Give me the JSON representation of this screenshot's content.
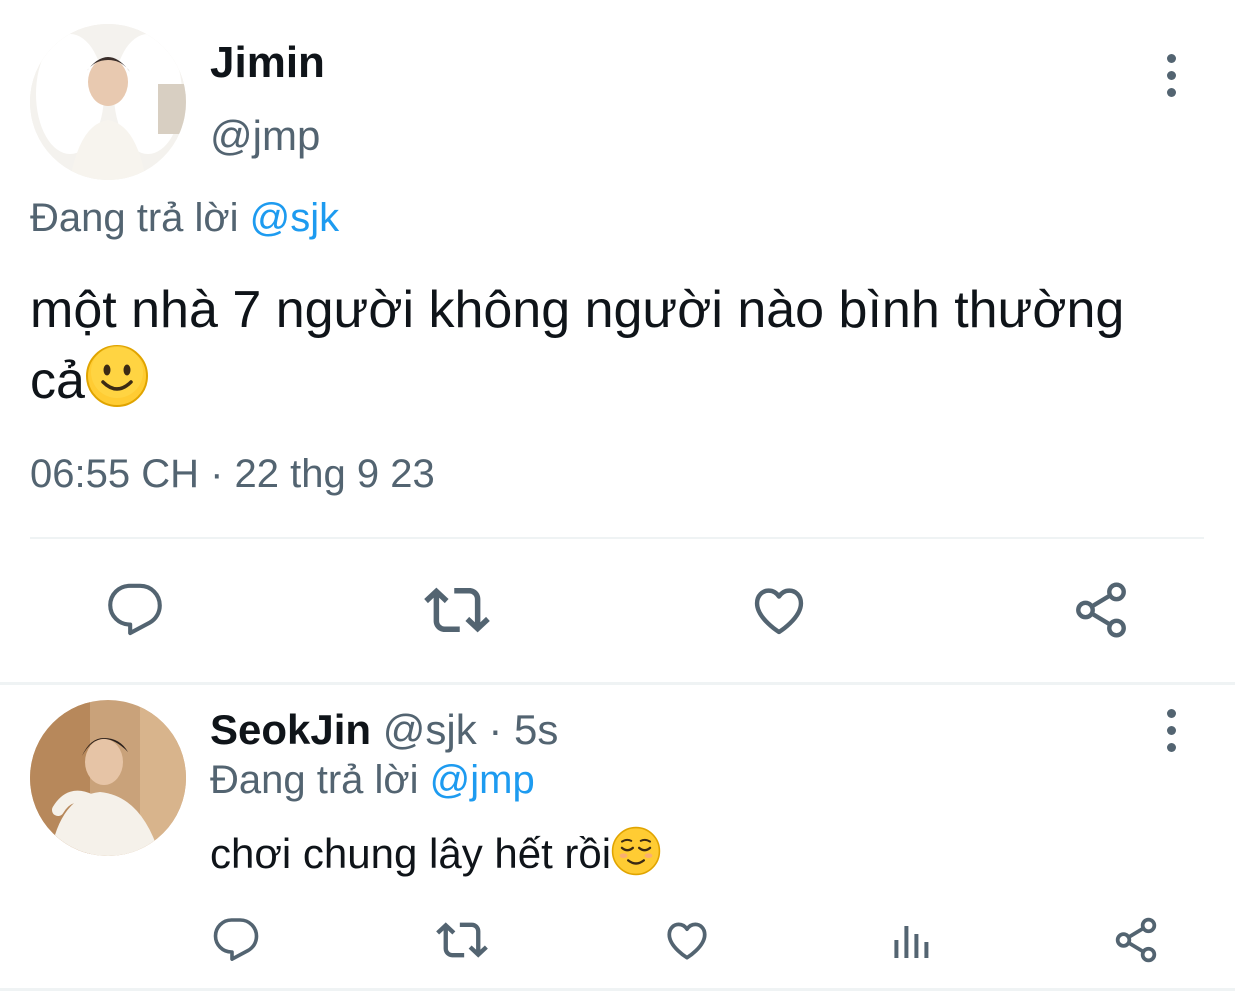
{
  "main_tweet": {
    "display_name": "Jimin",
    "handle": "@jmp",
    "replying_to_prefix": "Đang trả lời ",
    "replying_to_handle": "@sjk",
    "text": "một nhà 7 người không người nào bình thường cả",
    "emoji": "slightly-smiling-face",
    "timestamp": "06:55 CH · 22 thg 9 23",
    "actions": [
      "reply-icon",
      "retweet-icon",
      "like-icon",
      "share-icon"
    ]
  },
  "reply_tweet": {
    "display_name": "SeokJin",
    "handle": "@sjk",
    "separator": " · ",
    "time_ago": "5s",
    "replying_to_prefix": "Đang trả lời ",
    "replying_to_handle": "@jmp",
    "text": "chơi chung lây hết rồi",
    "emoji": "relieved-face",
    "actions": [
      "reply-icon",
      "retweet-icon",
      "like-icon",
      "analytics-icon",
      "share-icon"
    ]
  },
  "colors": {
    "primary_text": "#0f1419",
    "secondary_text": "#536471",
    "accent": "#1d9bf0",
    "divider": "#eff3f4"
  }
}
